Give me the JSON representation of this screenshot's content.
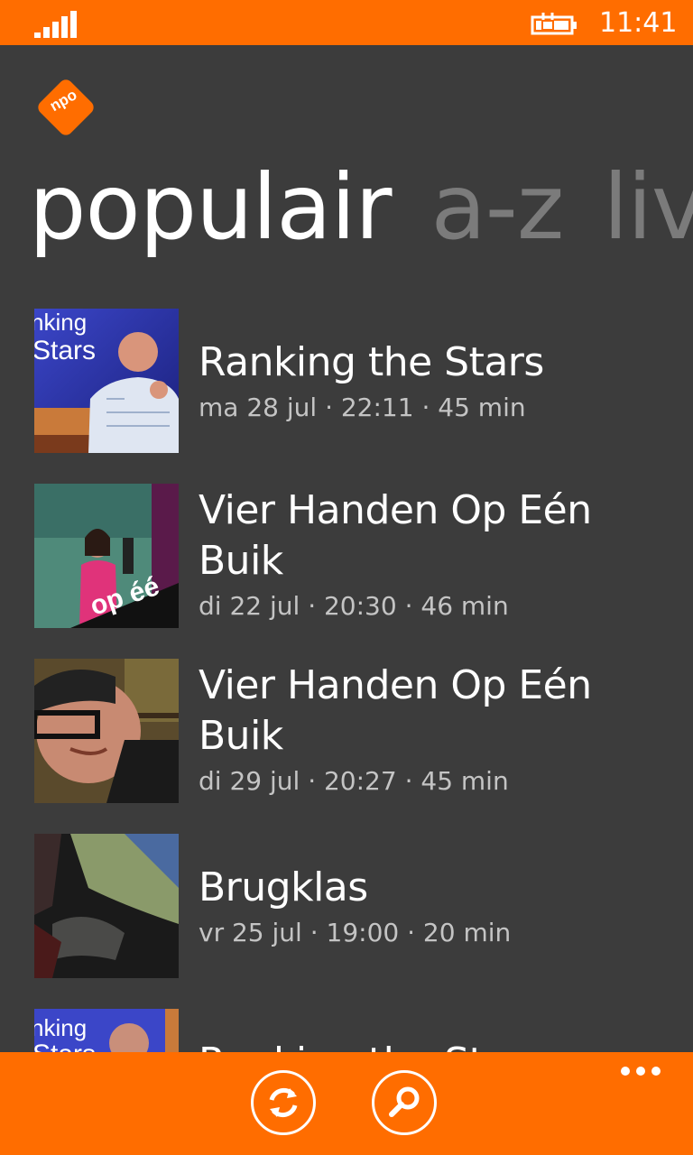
{
  "status_bar": {
    "time": "11:41",
    "signal_icon": "signal-bars-icon",
    "battery_icon": "battery-charging-icon"
  },
  "app": {
    "logo_text": "npo",
    "accent_color": "#ff6d00",
    "background_color": "#3c3c3c"
  },
  "pivot": {
    "tabs": [
      {
        "label": "populair",
        "active": true
      },
      {
        "label": "a-z",
        "active": false
      },
      {
        "label": "live",
        "active": false
      }
    ]
  },
  "list": {
    "items": [
      {
        "title": "Ranking the Stars",
        "subtitle": "ma 28 jul · 22:11 · 45 min"
      },
      {
        "title": "Vier Handen Op Eén Buik",
        "subtitle": "di 22 jul · 20:30 · 46 min"
      },
      {
        "title": "Vier Handen Op Eén Buik",
        "subtitle": "di 29 jul · 20:27 · 45 min"
      },
      {
        "title": "Brugklas",
        "subtitle": "vr 25 jul · 19:00 · 20 min"
      },
      {
        "title": "Ranking the Stars",
        "subtitle": ""
      }
    ]
  },
  "app_bar": {
    "buttons": [
      {
        "icon": "refresh-icon"
      },
      {
        "icon": "search-icon"
      }
    ],
    "more_icon": "more-ellipsis-icon"
  }
}
